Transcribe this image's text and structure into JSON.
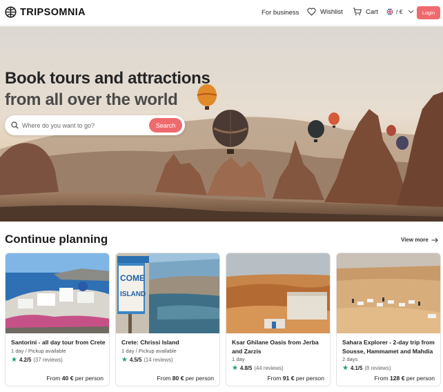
{
  "header": {
    "logo": "TRIPSOMNIA",
    "for_business": "For business",
    "wishlist": "Wishlist",
    "cart": "Cart",
    "locale": "/ €",
    "login": "Login",
    "brand_color": "#ee6a6c"
  },
  "hero": {
    "title_line1": "Book tours and attractions",
    "title_line2": "from all over the world",
    "search_placeholder": "Where do you want to go?",
    "search_button": "Search"
  },
  "section": {
    "title": "Continue planning",
    "view_more": "View more"
  },
  "cards": [
    {
      "title": "Santorini - all day tour from Crete",
      "meta": "1 day / Pickup available",
      "score": "4.2/5",
      "reviews": "(37 reviews)",
      "price_prefix": "From",
      "price": "40 €",
      "price_suffix": "per person"
    },
    {
      "title": "Crete: Chrissi Island",
      "meta": "1 day / Pickup available",
      "score": "4.5/5",
      "reviews": "(14 reviews)",
      "price_prefix": "From",
      "price": "80 €",
      "price_suffix": "per person",
      "sign_text_1": "COME",
      "sign_text_2": "ISLAND"
    },
    {
      "title": "Ksar Ghilane Oasis from Jerba and Zarzis",
      "meta": "1 day",
      "score": "4.8/5",
      "reviews": "(44 reviews)",
      "price_prefix": "From",
      "price": "91 €",
      "price_suffix": "per person"
    },
    {
      "title": "Sahara Explorer - 2-day trip from Sousse, Hammamet and Mahdia",
      "meta": "2 days",
      "score": "4.1/5",
      "reviews": "(8 reviews)",
      "price_prefix": "From",
      "price": "128 €",
      "price_suffix": "per person"
    }
  ]
}
